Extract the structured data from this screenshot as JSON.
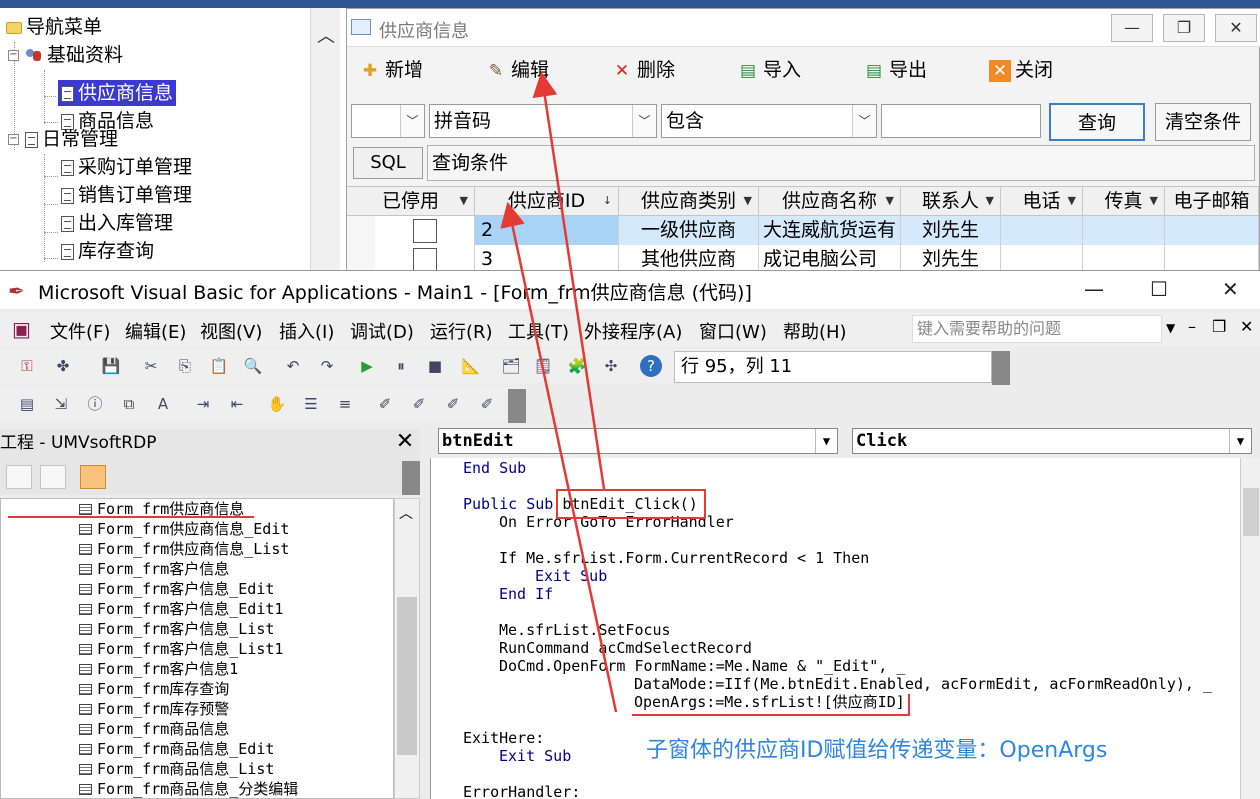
{
  "nav": {
    "title": "导航菜单",
    "groups": [
      {
        "label": "基础资料",
        "items": [
          "供应商信息",
          "商品信息"
        ]
      },
      {
        "label": "日常管理",
        "items": [
          "采购订单管理",
          "销售订单管理",
          "出入库管理",
          "库存查询"
        ]
      }
    ]
  },
  "supplier_window": {
    "title": "供应商信息",
    "toolbar": {
      "add": "新增",
      "edit": "编辑",
      "delete": "删除",
      "import": "导入",
      "export": "导出",
      "close": "关闭"
    },
    "filter": {
      "field_empty": "",
      "field": "拼音码",
      "operator": "包含",
      "value": "",
      "query": "查询",
      "clear": "清空条件"
    },
    "sql_button": "SQL",
    "sql_label": "查询条件",
    "columns": [
      "已停用",
      "供应商ID",
      "供应商类别",
      "供应商名称",
      "联系人",
      "电话",
      "传真",
      "电子邮箱"
    ],
    "rows": [
      {
        "id": "2",
        "category": "一级供应商",
        "name": "大连威航货运有",
        "contact": "刘先生"
      },
      {
        "id": "3",
        "category": "其他供应商",
        "name": "成记电脑公司",
        "contact": "刘先生"
      }
    ]
  },
  "vba": {
    "title": "Microsoft Visual Basic for Applications - Main1 - [Form_frm供应商信息 (代码)]",
    "menus": [
      "文件(F)",
      "编辑(E)",
      "视图(V)",
      "插入(I)",
      "调试(D)",
      "运行(R)",
      "工具(T)",
      "外接程序(A)",
      "窗口(W)",
      "帮助(H)"
    ],
    "help_placeholder": "键入需要帮助的问题",
    "position": "行 95，列 11",
    "project_title": "工程 - UMVsoftRDP",
    "project_items": [
      "Form_frm供应商信息",
      "Form_frm供应商信息_Edit",
      "Form_frm供应商信息_List",
      "Form_frm客户信息",
      "Form_frm客户信息_Edit",
      "Form_frm客户信息_Edit1",
      "Form_frm客户信息_List",
      "Form_frm客户信息_List1",
      "Form_frm客户信息1",
      "Form_frm库存查询",
      "Form_frm库存预警",
      "Form_frm商品信息",
      "Form_frm商品信息_Edit",
      "Form_frm商品信息_List",
      "Form_frm商品信息_分类编辑"
    ],
    "object_combo": "btnEdit",
    "proc_combo": "Click",
    "code": {
      "end_sub": "End Sub",
      "sub_kw": "Public Sub",
      "sub_name": "btnEdit_Click()",
      "on_error": "On Error GoTo ErrorHandler",
      "if_line": "If Me.sfrList.Form.CurrentRecord < 1 Then",
      "exit_sub_inner": "Exit Sub",
      "end_if": "End If",
      "setfocus": "Me.sfrList.SetFocus",
      "runcommand": "RunCommand acCmdSelectRecord",
      "openform": "DoCmd.OpenForm FormName:=Me.Name & \"_Edit\", _",
      "datamode": "DataMode:=IIf(Me.btnEdit.Enabled, acFormEdit, acFormReadOnly), _",
      "openargs": "OpenArgs:=Me.sfrList![供应商ID]",
      "exithere": "ExitHere:",
      "exit_sub": "Exit Sub",
      "errorhandler": "ErrorHandler:"
    }
  },
  "annotation": "子窗体的供应商ID赋值给传递变量：OpenArgs",
  "colors": {
    "annotation_red": "#e53935",
    "annotation_blue": "#2e86de",
    "selection": "#3a3ad0",
    "code_keyword": "#00008b"
  }
}
